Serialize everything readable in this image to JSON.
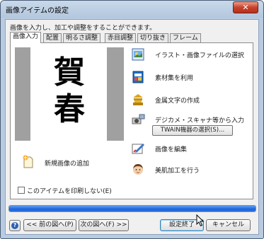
{
  "window": {
    "title": "画像アイテムの設定",
    "close_glyph": "✕"
  },
  "description": "画像を入力し、加工や調整をすることができます。",
  "tabs": [
    {
      "label": "画像入力",
      "active": true
    },
    {
      "label": "配置",
      "active": false
    },
    {
      "label": "明るさ調整",
      "active": false
    },
    {
      "label": "赤目調整",
      "active": false
    },
    {
      "label": "切り抜き",
      "active": false
    },
    {
      "label": "フレーム",
      "active": false
    }
  ],
  "preview": {
    "glyph_top": "賀",
    "glyph_bottom": "春"
  },
  "actions": {
    "select_file": {
      "label": "イラスト・画像ファイルの選択",
      "icon": "image-file-icon"
    },
    "material": {
      "label": "素材集を利用",
      "icon": "material-book-icon"
    },
    "gold_text": {
      "label": "金属文字の作成",
      "icon": "gold-letter-icon"
    },
    "scanner": {
      "label": "デジカメ・スキャナ等から入力",
      "icon": "scanner-icon",
      "twain_button": "TWAIN機器の選択(S)..."
    },
    "edit": {
      "label": "画像を編集",
      "icon": "edit-image-icon"
    },
    "beauty": {
      "label": "美肌加工を行う",
      "icon": "face-icon"
    }
  },
  "new_image": {
    "label": "新規画像の追加",
    "icon": "new-image-icon"
  },
  "no_print": {
    "label": "このアイテムを印刷しない(E)",
    "checked": false
  },
  "progress": {
    "fraction": 1.0,
    "color": "#2a70e0"
  },
  "buttons": {
    "help_glyph": "?",
    "prev": "<< 前の図へ(P)",
    "next": "次の図へ(F) >>",
    "finish": "設定終了",
    "cancel": "キャンセル"
  }
}
